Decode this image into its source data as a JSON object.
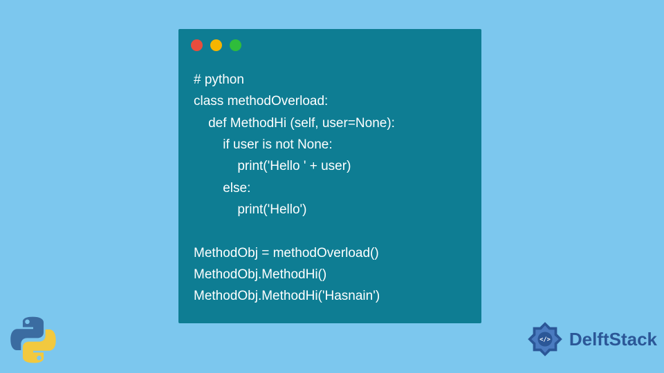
{
  "code": {
    "lines": [
      "# python",
      "class methodOverload:",
      "    def MethodHi (self, user=None):",
      "        if user is not None:",
      "            print('Hello ' + user)",
      "        else:",
      "            print('Hello')",
      "",
      "MethodObj = methodOverload()",
      "MethodObj.MethodHi()",
      "MethodObj.MethodHi('Hasnain')"
    ]
  },
  "branding": {
    "delft_text": "DelftStack"
  },
  "colors": {
    "background": "#7cc7ee",
    "window_bg": "#0e7d93",
    "traffic_red": "#e84d3d",
    "traffic_yellow": "#f6b500",
    "traffic_green": "#2fbd3b",
    "delft_blue": "#2b5797"
  }
}
